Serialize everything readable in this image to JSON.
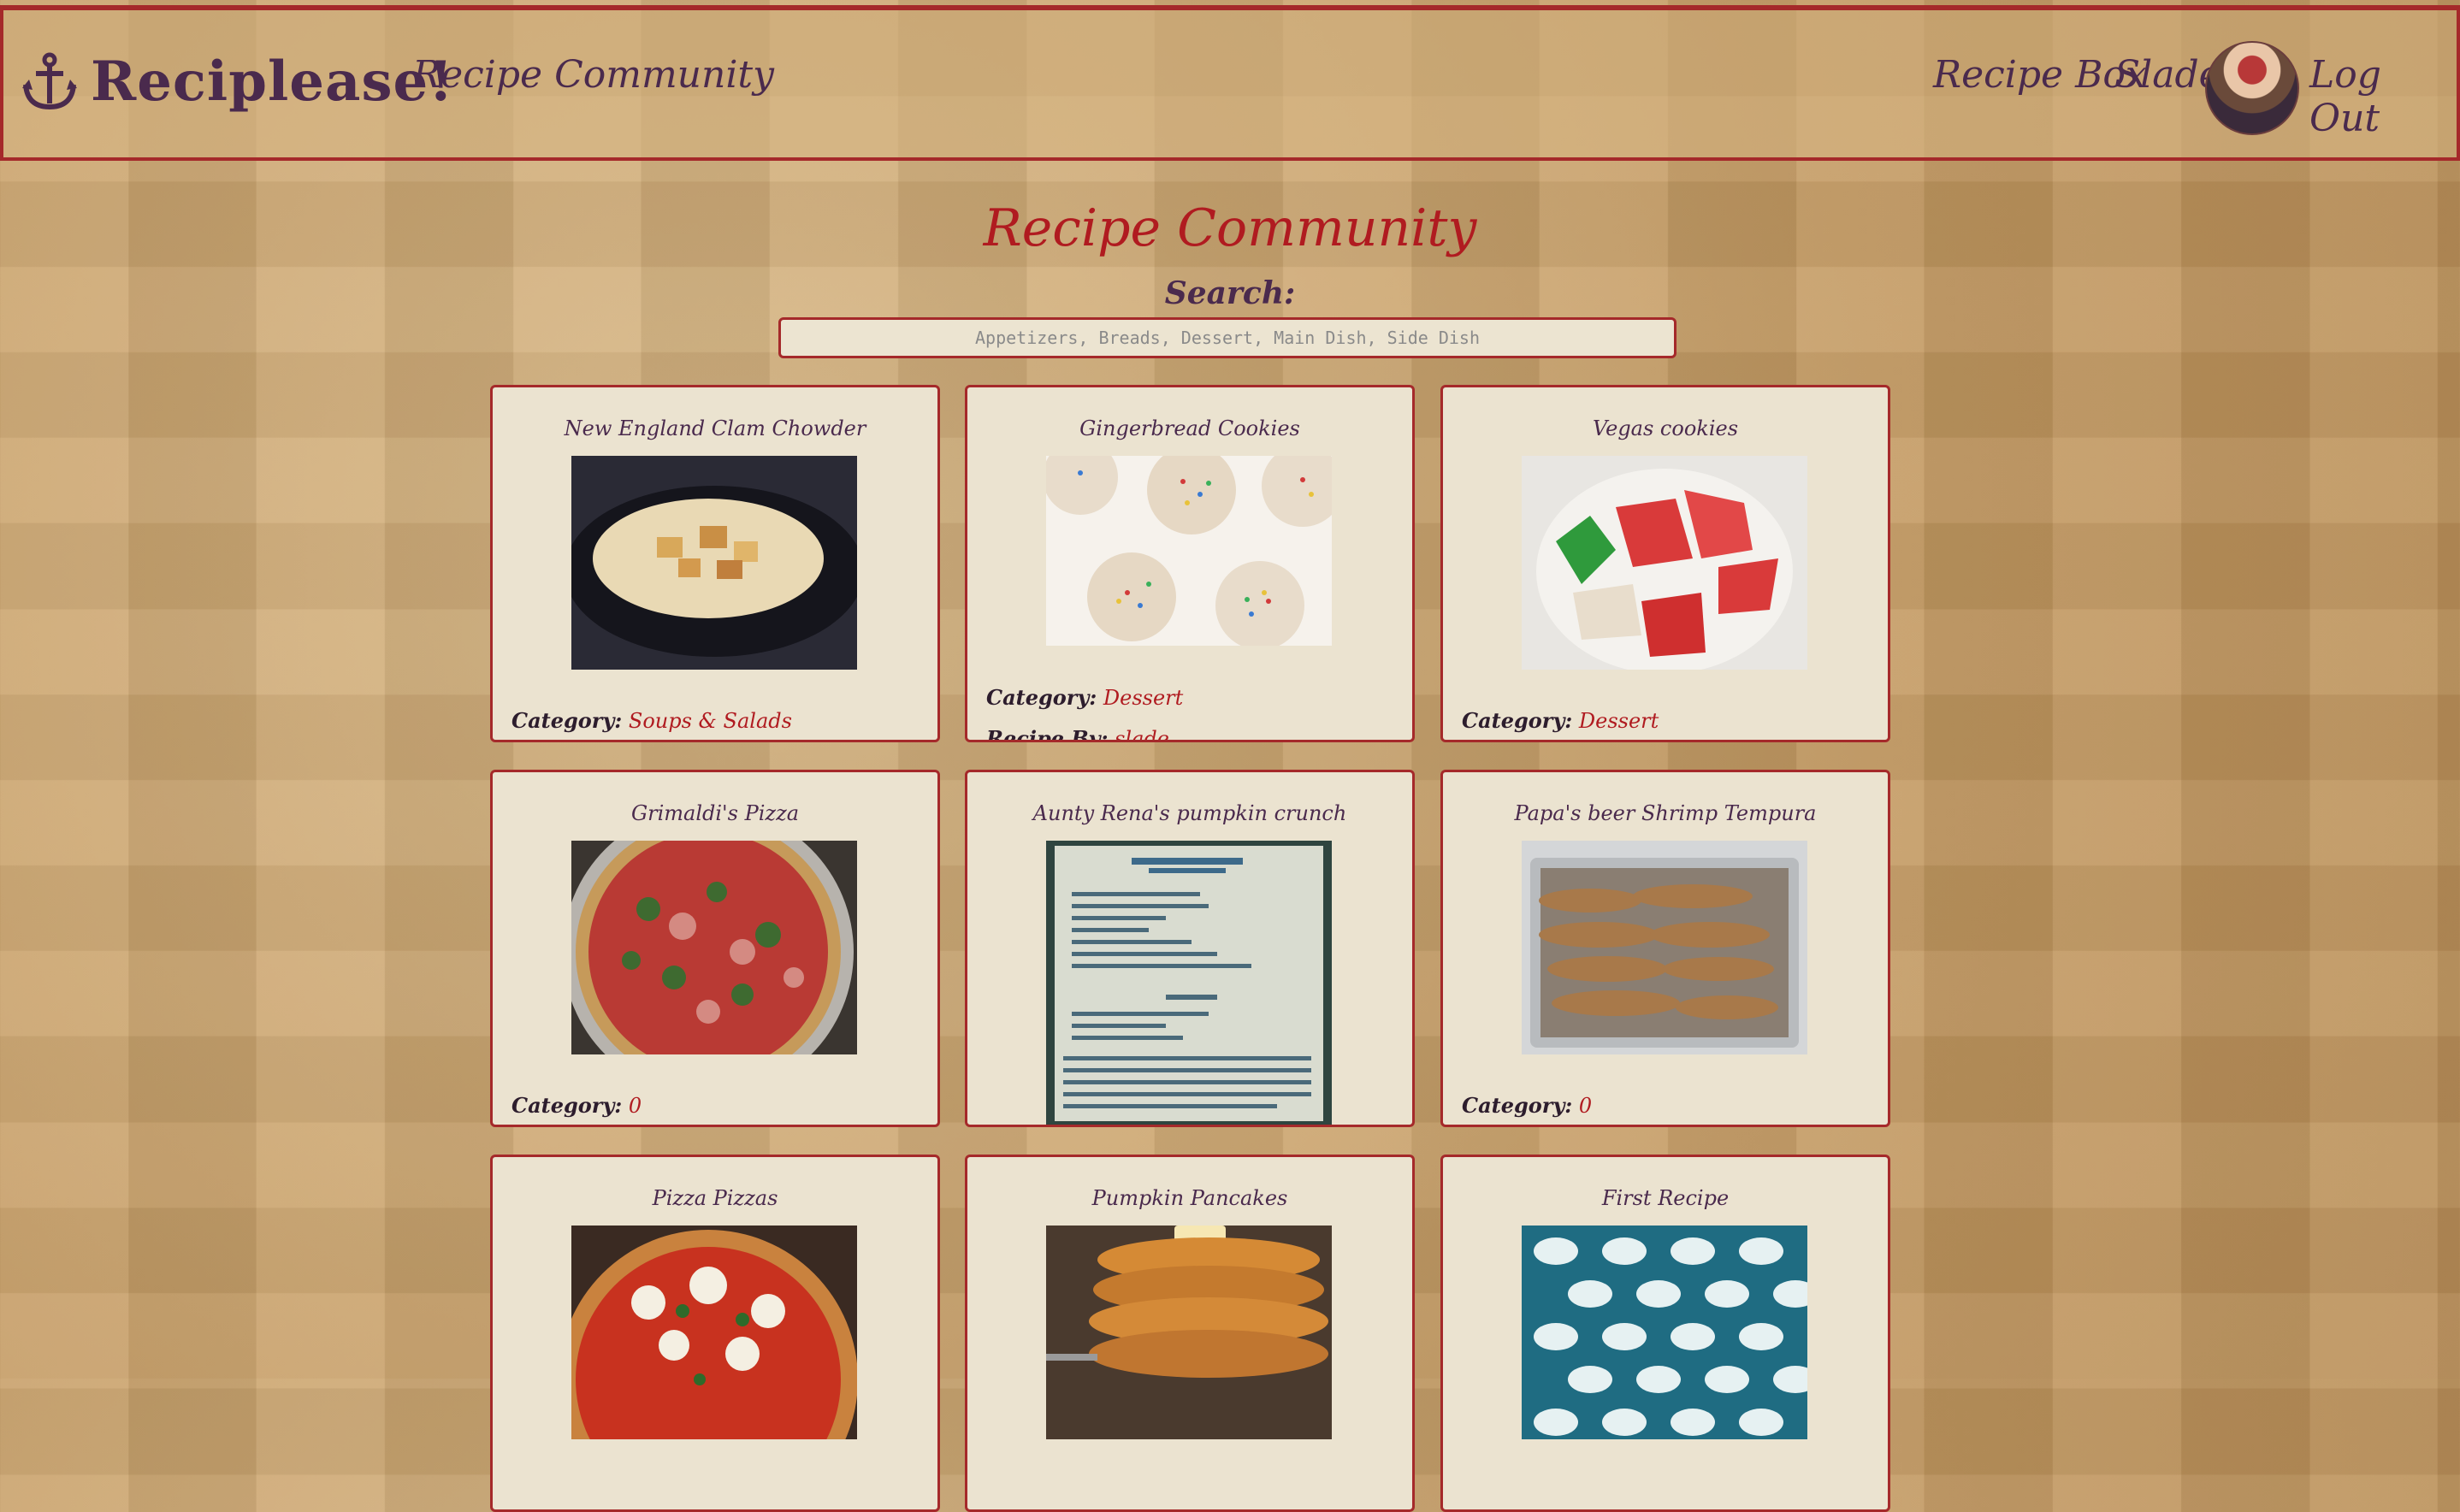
{
  "nav": {
    "brand": "Reciplease!",
    "community_link": "Recipe Community",
    "recipe_box_link": "Recipe Box",
    "username": "Slade",
    "logout_link": "Log Out"
  },
  "page": {
    "title": "Recipe Community",
    "search_label": "Search:",
    "search_placeholder": "Appetizers, Breads, Dessert, Main Dish, Side Dish"
  },
  "meta_labels": {
    "category": "Category:",
    "recipe_by": "Recipe By:"
  },
  "recipes": [
    {
      "title": "New England Clam Chowder",
      "category": "Soups & Salads"
    },
    {
      "title": "Gingerbread Cookies",
      "category": "Dessert",
      "recipe_by": "slade"
    },
    {
      "title": "Vegas cookies",
      "category": "Dessert"
    },
    {
      "title": "Grimaldi's Pizza",
      "category": "0"
    },
    {
      "title": "Aunty Rena's pumpkin crunch"
    },
    {
      "title": "Papa's beer Shrimp Tempura",
      "category": "0"
    },
    {
      "title": "Pizza Pizzas"
    },
    {
      "title": "Pumpkin Pancakes"
    },
    {
      "title": "First Recipe"
    }
  ],
  "colors": {
    "accent_red": "#a5292a",
    "title_red": "#b01b20",
    "purple_text": "#4a2a4d",
    "card_bg": "#ebe3d0"
  }
}
